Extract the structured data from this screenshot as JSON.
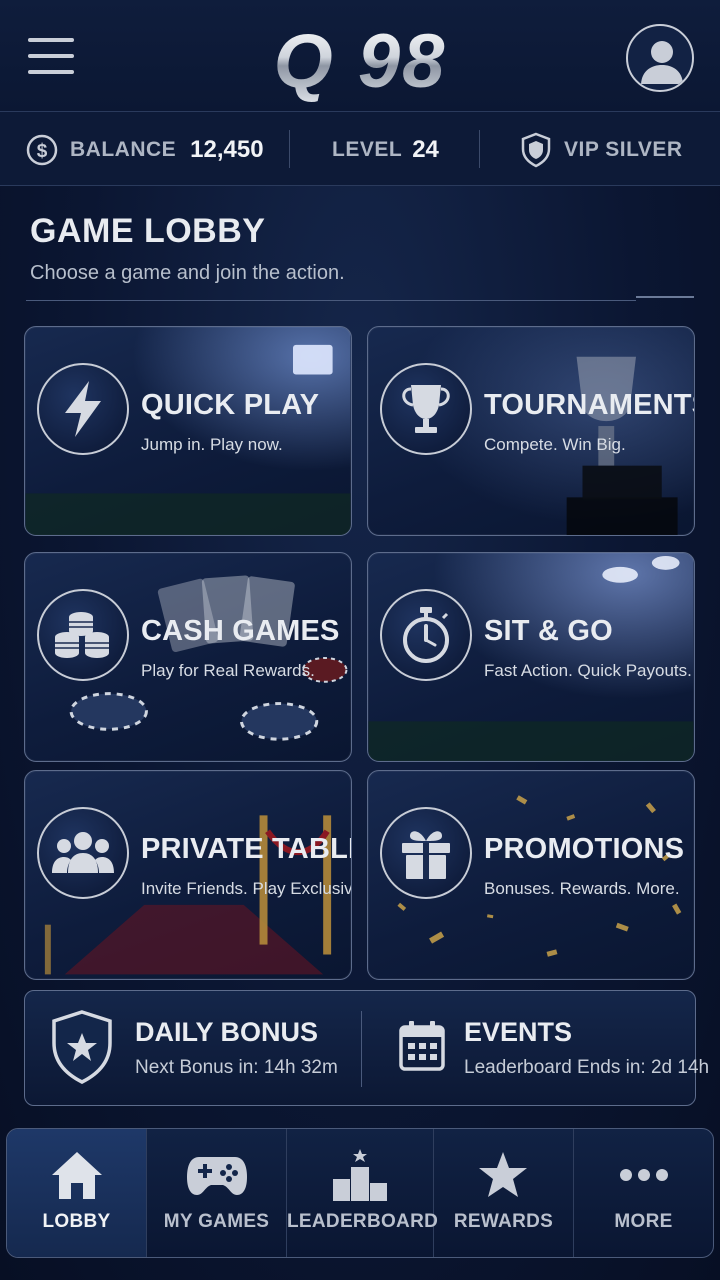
{
  "app": {
    "logo_text": "Q 98"
  },
  "status": {
    "balance_label": "BALANCE",
    "balance_value": "12,450",
    "level_label": "LEVEL",
    "level_value": "24",
    "vip_label": "VIP SILVER"
  },
  "lobby": {
    "title": "GAME LOBBY",
    "subtitle": "Choose a game and join the action."
  },
  "cards": [
    {
      "title": "QUICK PLAY",
      "subtitle": "Jump in. Play now.",
      "icon": "lightning-icon"
    },
    {
      "title": "TOURNAMENTS",
      "subtitle": "Compete. Win Big.",
      "icon": "trophy-icon"
    },
    {
      "title": "CASH GAMES",
      "subtitle": "Play for Real Rewards.",
      "icon": "chips-icon"
    },
    {
      "title": "SIT & GO",
      "subtitle": "Fast Action. Quick Payouts.",
      "icon": "stopwatch-icon"
    },
    {
      "title": "PRIVATE TABLES",
      "subtitle": "Invite Friends. Play Exclusive.",
      "icon": "group-icon"
    },
    {
      "title": "PROMOTIONS",
      "subtitle": "Bonuses. Rewards. More.",
      "icon": "gift-icon"
    }
  ],
  "bonus": {
    "daily_title": "DAILY BONUS",
    "daily_sub": "Next Bonus in: 14h 32m",
    "events_title": "EVENTS",
    "events_sub": "Leaderboard Ends in: 2d 14h"
  },
  "nav": [
    {
      "label": "LOBBY",
      "icon": "home-icon",
      "active": true
    },
    {
      "label": "MY GAMES",
      "icon": "gamepad-icon",
      "active": false
    },
    {
      "label": "LEADERBOARD",
      "icon": "podium-icon",
      "active": false
    },
    {
      "label": "REWARDS",
      "icon": "star-icon",
      "active": false
    },
    {
      "label": "MORE",
      "icon": "more-icon",
      "active": false
    }
  ],
  "colors": {
    "background": "#0b1632",
    "card_border": "#5d6c8c",
    "text_primary": "#e9ecf1",
    "accent_red": "#b3262e",
    "accent_gold": "#c9a24a"
  }
}
